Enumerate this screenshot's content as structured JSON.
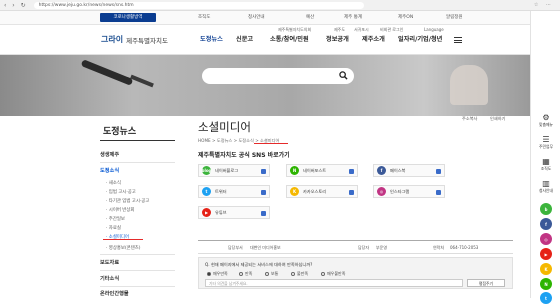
{
  "browser": {
    "url": "https://www.jeju.go.kr/news/news/sns.htm"
  },
  "util_bar": {
    "badge": "코로나생활방역",
    "links": [
      "조직도",
      "청사안내",
      "예산",
      "제주 통계",
      "제주ON",
      "알림정원"
    ]
  },
  "header": {
    "logo_mark": "그라이",
    "logo_text": "제주특별자치도",
    "sub_links": [
      "제주특별자치도의회",
      "제주도",
      "서귀포시",
      "비회관 로그인",
      "Language"
    ],
    "gnb": [
      "도정뉴스",
      "신문고",
      "소통/참여/민원",
      "정보공개",
      "제주소개",
      "일자리/기업/청년"
    ]
  },
  "lnb": {
    "title": "도정뉴스",
    "items": [
      {
        "label": "생생제주"
      },
      {
        "label": "도정소식"
      },
      {
        "label": "보도자료"
      },
      {
        "label": "기타소식"
      },
      {
        "label": "온라인간행물"
      }
    ],
    "sub_items": [
      {
        "label": "· 새소식"
      },
      {
        "label": "· 입법 고시·공고"
      },
      {
        "label": "· 타기관 입법 고시·공고"
      },
      {
        "label": "· 시이버 반상회"
      },
      {
        "label": "· 주간일보"
      },
      {
        "label": "· 자료실"
      },
      {
        "label": "· 소셜미디어"
      },
      {
        "label": "· 영상홍보(콘텐츠)"
      }
    ]
  },
  "page": {
    "title": "소셜미디어",
    "tools": [
      "주소복사",
      "인쇄하기"
    ],
    "breadcrumb": "HOME > 도정뉴스 > 도정소식 > 소셜미디어",
    "section_title": "제주특별자치도 공식 SNS 바로가기",
    "sns": [
      {
        "label": "네이버블로그",
        "icon": "naver-blog-icon",
        "color": "#3cb43c",
        "mark": "blog"
      },
      {
        "label": "네이버포스트",
        "icon": "naver-post-icon",
        "color": "#2db400",
        "mark": "N"
      },
      {
        "label": "페이스북",
        "icon": "facebook-icon",
        "color": "#3b5998",
        "mark": "f"
      },
      {
        "label": "트위터",
        "icon": "twitter-icon",
        "color": "#1da1f2",
        "mark": "t"
      },
      {
        "label": "카카오스토리",
        "icon": "kakaostory-icon",
        "color": "#f5b800",
        "mark": "K"
      },
      {
        "label": "인스타그램",
        "icon": "instagram-icon",
        "color": "#c13584",
        "mark": "◎"
      },
      {
        "label": "유튜브",
        "icon": "youtube-icon",
        "color": "#e62117",
        "mark": "▶"
      }
    ],
    "info": {
      "dept_label": "담당부서",
      "dept_value": "대변인 미디어홍보",
      "person_label": "담당자",
      "person_value": "부운영",
      "phone_label": "연락처",
      "phone_value": "064-710-2053"
    },
    "survey": {
      "question": "Q. 현재 페이지에서 제공되는 서비스에 대하여 만족하십니까?",
      "options": [
        "매우만족",
        "만족",
        "보통",
        "불만족",
        "매우불만족"
      ],
      "placeholder": "기타 의견을 남겨주세요.",
      "submit": "평점주기"
    }
  },
  "quick": {
    "items": [
      {
        "label": "맞춤메뉴",
        "icon": "gear-icon",
        "glyph": "⚙"
      },
      {
        "label": "주민업무",
        "icon": "document-icon",
        "glyph": "☰"
      },
      {
        "label": "조직도",
        "icon": "org-chart-icon",
        "glyph": "▦"
      },
      {
        "label": "청사안내",
        "icon": "building-icon",
        "glyph": "▥"
      }
    ],
    "circles": [
      {
        "icon": "naver-blog-icon",
        "color": "#3cb43c",
        "mark": "b"
      },
      {
        "icon": "facebook-icon",
        "color": "#3b5998",
        "mark": "f"
      },
      {
        "icon": "instagram-icon",
        "color": "#c13584",
        "mark": "◎"
      },
      {
        "icon": "youtube-icon",
        "color": "#e62117",
        "mark": "▶"
      },
      {
        "icon": "kakaostory-icon",
        "color": "#f5b800",
        "mark": "K"
      },
      {
        "icon": "naver-post-icon",
        "color": "#2db400",
        "mark": "N"
      },
      {
        "icon": "twitter-icon",
        "color": "#1da1f2",
        "mark": "t"
      }
    ]
  }
}
